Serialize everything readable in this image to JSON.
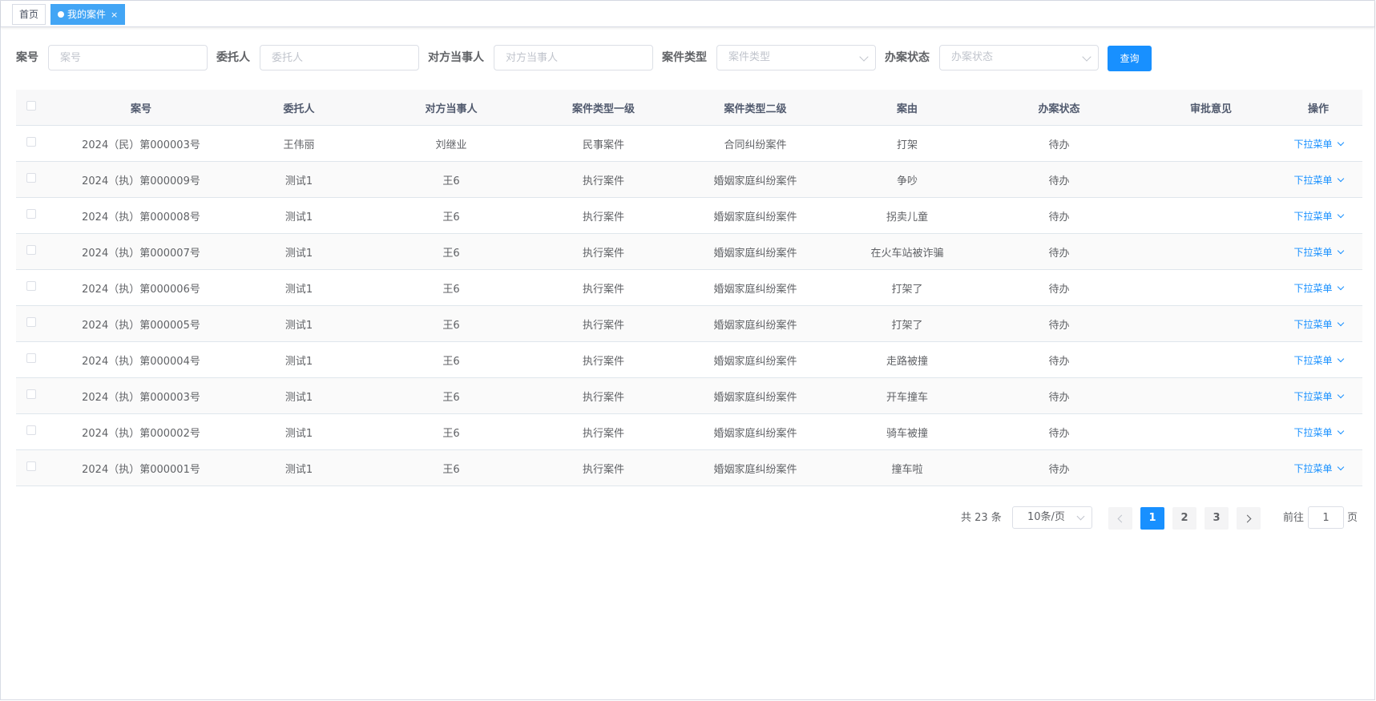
{
  "tabs": [
    {
      "label": "首页",
      "active": false
    },
    {
      "label": "我的案件",
      "active": true,
      "close": "×"
    }
  ],
  "search": {
    "case_no": {
      "label": "案号",
      "placeholder": "案号"
    },
    "client": {
      "label": "委托人",
      "placeholder": "委托人"
    },
    "opposing": {
      "label": "对方当事人",
      "placeholder": "对方当事人"
    },
    "case_type": {
      "label": "案件类型",
      "placeholder": "案件类型"
    },
    "status": {
      "label": "办案状态",
      "placeholder": "办案状态"
    },
    "query_label": "查询"
  },
  "table": {
    "headers": [
      "案号",
      "委托人",
      "对方当事人",
      "案件类型一级",
      "案件类型二级",
      "案由",
      "办案状态",
      "审批意见",
      "操作"
    ],
    "action_label": "下拉菜单",
    "rows": [
      [
        "2024（民）第000003号",
        "王伟丽",
        "刘继业",
        "民事案件",
        "合同纠纷案件",
        "打架",
        "待办",
        ""
      ],
      [
        "2024（执）第000009号",
        "测试1",
        "王6",
        "执行案件",
        "婚姻家庭纠纷案件",
        "争吵",
        "待办",
        ""
      ],
      [
        "2024（执）第000008号",
        "测试1",
        "王6",
        "执行案件",
        "婚姻家庭纠纷案件",
        "拐卖儿童",
        "待办",
        ""
      ],
      [
        "2024（执）第000007号",
        "测试1",
        "王6",
        "执行案件",
        "婚姻家庭纠纷案件",
        "在火车站被诈骗",
        "待办",
        ""
      ],
      [
        "2024（执）第000006号",
        "测试1",
        "王6",
        "执行案件",
        "婚姻家庭纠纷案件",
        "打架了",
        "待办",
        ""
      ],
      [
        "2024（执）第000005号",
        "测试1",
        "王6",
        "执行案件",
        "婚姻家庭纠纷案件",
        "打架了",
        "待办",
        ""
      ],
      [
        "2024（执）第000004号",
        "测试1",
        "王6",
        "执行案件",
        "婚姻家庭纠纷案件",
        "走路被撞",
        "待办",
        ""
      ],
      [
        "2024（执）第000003号",
        "测试1",
        "王6",
        "执行案件",
        "婚姻家庭纠纷案件",
        "开车撞车",
        "待办",
        ""
      ],
      [
        "2024（执）第000002号",
        "测试1",
        "王6",
        "执行案件",
        "婚姻家庭纠纷案件",
        "骑车被撞",
        "待办",
        ""
      ],
      [
        "2024（执）第000001号",
        "测试1",
        "王6",
        "执行案件",
        "婚姻家庭纠纷案件",
        "撞车啦",
        "待办",
        ""
      ]
    ]
  },
  "pagination": {
    "total": "共 23 条",
    "page_size": "10条/页",
    "pages": [
      "1",
      "2",
      "3"
    ],
    "current": "1",
    "goto_label": "前往",
    "goto_value": "1",
    "page_suffix": "页"
  },
  "colors": {
    "primary": "#1890ff",
    "tag_active": "#42a5f5"
  }
}
